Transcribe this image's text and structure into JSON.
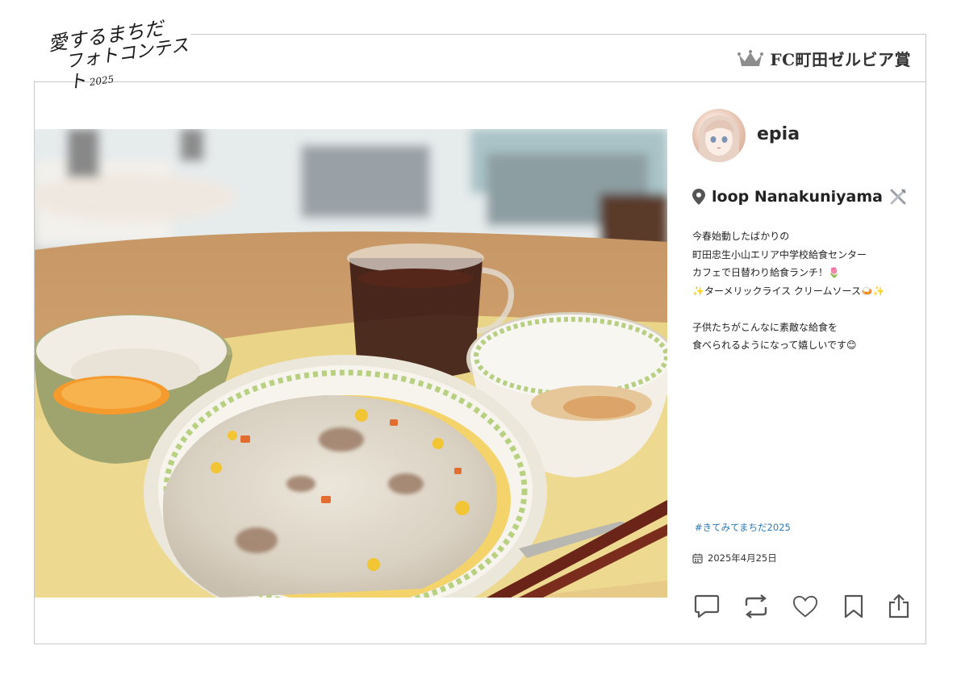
{
  "contest": {
    "logo_line1": "愛するまちだ",
    "logo_line2": "フォトコンテスト",
    "logo_year": "2025",
    "award_label": "FC町田ゼルビア賞",
    "award_icon": "crown-icon"
  },
  "post": {
    "username": "epia",
    "location": "loop Nanakuniyama",
    "location_icon": "map-pin-icon",
    "location_emoji": "fork-and-knife-emoji",
    "caption_lines": [
      "今春始動したばかりの",
      "町田忠生小山エリア中学校給食センター",
      "カフェで日替わり給食ランチ！🌷",
      "✨ターメリックライス クリームソース🍛✨",
      "",
      "子供たちがこんなに素敵な給食を",
      "食べられるようになって嬉しいです😊"
    ],
    "hashtag": "#きてみてまちだ2025",
    "date": "2025年4月25日",
    "date_icon": "calendar-icon"
  },
  "actions": [
    "comment-icon",
    "repost-icon",
    "heart-icon",
    "bookmark-icon",
    "share-icon"
  ],
  "colors": {
    "border": "#c9c9c9",
    "hashtag": "#2a78b5",
    "icon": "#555555",
    "crown": "#8d8d8d"
  }
}
